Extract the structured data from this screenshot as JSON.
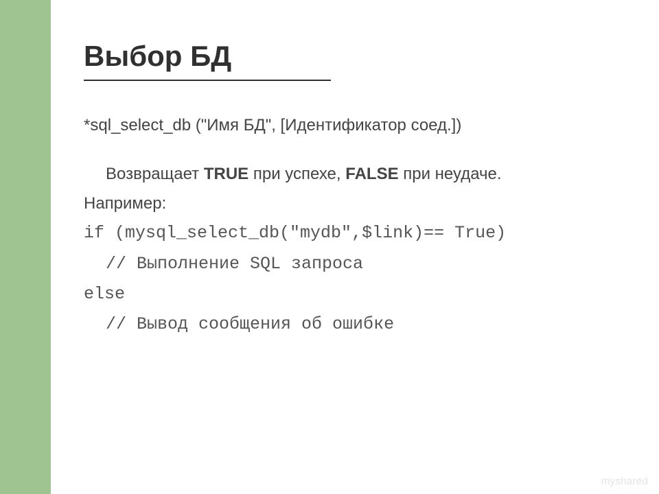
{
  "slide": {
    "title": "Выбор БД",
    "line1": "*sql_select_db (\"Имя БД\", [Идентификатор соед.])",
    "line2_pre": "Возвращает ",
    "line2_true": "TRUE",
    "line2_mid": " при успехе, ",
    "line2_false": "FALSE",
    "line2_post": " при неудаче.",
    "line3": "Например:",
    "code1": "if (mysql_select_db(\"mydb\",$link)== True)",
    "code2": "// Выполнение SQL запроса",
    "code3": "else",
    "code4": "// Вывод сообщения об ошибке",
    "watermark": "myshared"
  }
}
